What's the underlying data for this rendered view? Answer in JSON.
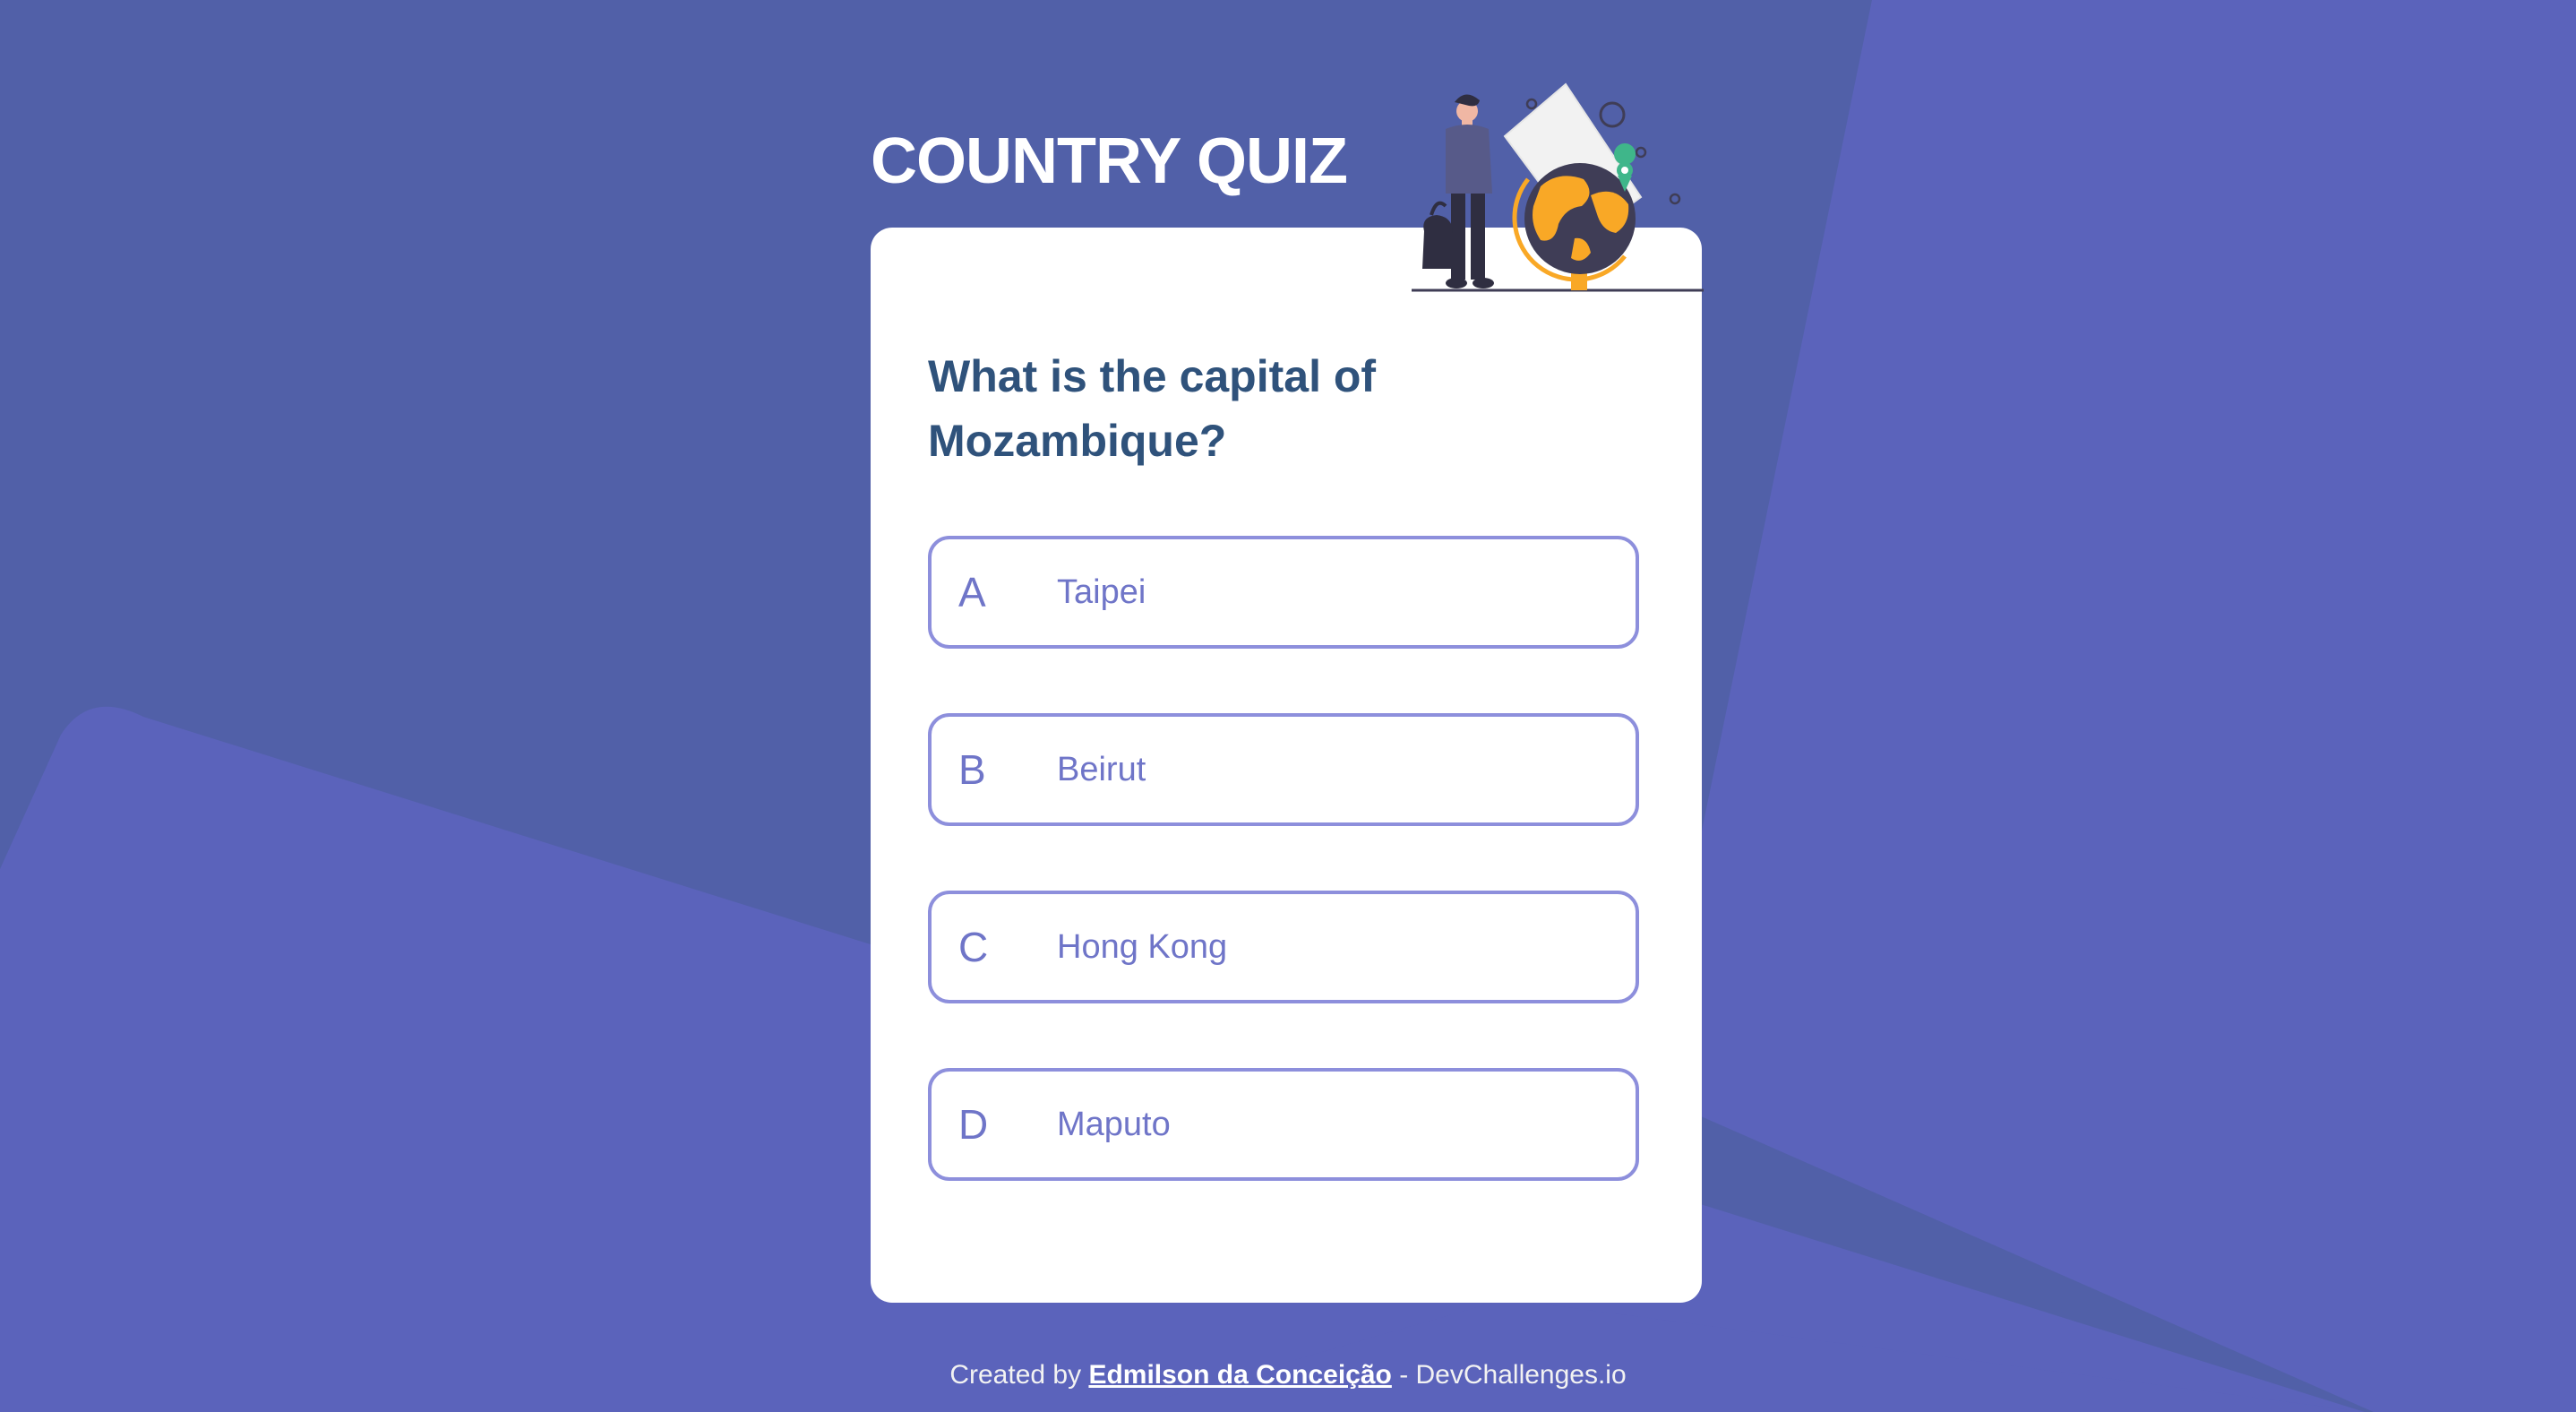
{
  "page": {
    "title": "COUNTRY QUIZ"
  },
  "colors": {
    "background": "#5160a8",
    "background_shape": "#5b63bb",
    "card": "#ffffff",
    "question_text": "#2f527b",
    "option_border": "#8d8fdc",
    "option_text": "#6f75c8",
    "globe_accent": "#f9a826"
  },
  "illustration": {
    "icon": "traveler-globe-illustration"
  },
  "quiz": {
    "question": "What is the capital of Mozambique?",
    "options": [
      {
        "letter": "A",
        "answer": "Taipei"
      },
      {
        "letter": "B",
        "answer": "Beirut"
      },
      {
        "letter": "C",
        "answer": "Hong Kong"
      },
      {
        "letter": "D",
        "answer": "Maputo"
      }
    ]
  },
  "footer": {
    "prefix": "Created by ",
    "author": "Edmilson da Conceição",
    "suffix": " - DevChallenges.io"
  }
}
